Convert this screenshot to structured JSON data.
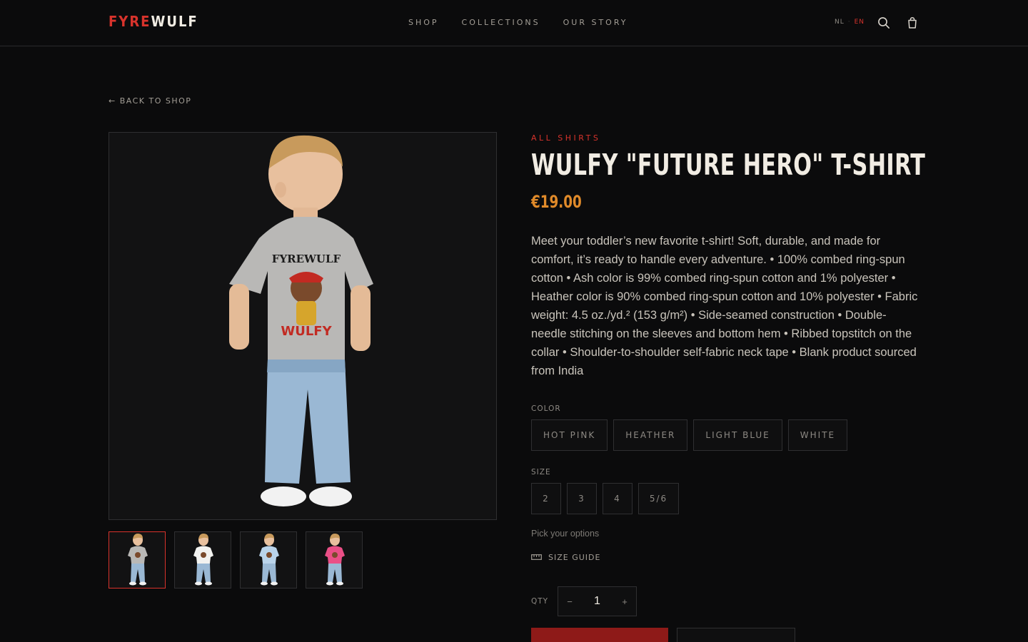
{
  "header": {
    "logo_part1": "FYRE",
    "logo_part2": "WULF",
    "nav": [
      {
        "label": "SHOP"
      },
      {
        "label": "COLLECTIONS"
      },
      {
        "label": "OUR STORY"
      }
    ],
    "lang_nl": "NL",
    "lang_sep": "·",
    "lang_en": "EN",
    "search_icon": "search-icon",
    "cart_icon": "shopping-bag-icon"
  },
  "back_link": "← BACK TO SHOP",
  "gallery": {
    "thumbnails": [
      {
        "shirt_color": "#b9b8b6",
        "active": true
      },
      {
        "shirt_color": "#f2f2f0",
        "active": false
      },
      {
        "shirt_color": "#b9d3ea",
        "active": false
      },
      {
        "shirt_color": "#ea4f86",
        "active": false
      }
    ]
  },
  "product": {
    "category": "ALL SHIRTS",
    "title": "WULFY \"FUTURE HERO\" T-SHIRT",
    "price": "€19.00",
    "description": "Meet your toddler’s new favorite t-shirt! Soft, durable, and made for comfort, it’s ready to handle every adventure. • 100% combed ring-spun cotton • Ash color is 99% combed ring-spun cotton and 1% polyester • Heather color is 90% combed ring-spun cotton and 10% polyester • Fabric weight: 4.5 oz./yd.² (153 g/m²) • Side-seamed construction • Double-needle stitching on the sleeves and bottom hem • Ribbed topstitch on the collar • Shoulder-to-shoulder self-fabric neck tape • Blank product sourced from India",
    "color_label": "COLOR",
    "colors": [
      {
        "label": "HOT PINK"
      },
      {
        "label": "HEATHER"
      },
      {
        "label": "LIGHT BLUE"
      },
      {
        "label": "WHITE"
      }
    ],
    "size_label": "SIZE",
    "sizes": [
      {
        "label": "2"
      },
      {
        "label": "3"
      },
      {
        "label": "4"
      },
      {
        "label": "5/6"
      }
    ],
    "hint": "Pick your options",
    "size_guide": "SIZE GUIDE",
    "qty_label": "QTY",
    "qty_minus": "−",
    "qty_value": "1",
    "qty_plus": "+"
  },
  "colors": {
    "accent_red": "#d8332c",
    "price_orange": "#e08a2a",
    "background": "#0b0b0c"
  }
}
